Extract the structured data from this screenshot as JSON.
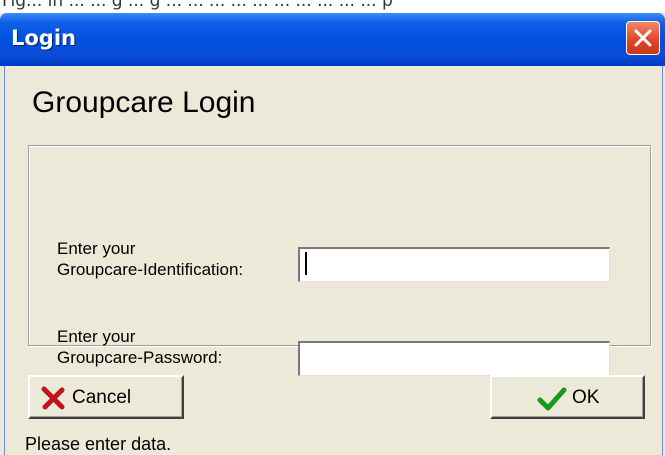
{
  "top_strip": {
    "text": "Fig... in ... ... g ... g ... ... ... ... ... ... ... ... ... ... p"
  },
  "window": {
    "title": "Login"
  },
  "heading": "Groupcare Login",
  "fields": {
    "identification": {
      "label_line1": "Enter your",
      "label_line2": "Groupcare-Identification:",
      "value": ""
    },
    "password": {
      "label_line1": "Enter your",
      "label_line2": "Groupcare-Password:",
      "value": ""
    }
  },
  "buttons": {
    "cancel": {
      "label": "Cancel",
      "icon": "red-x-icon"
    },
    "ok": {
      "label": "OK",
      "icon": "green-check-icon"
    },
    "close": {
      "icon": "close-icon"
    }
  },
  "status": "Please enter data.",
  "colors": {
    "titlebar": "#0050e0",
    "close": "#e0462a",
    "background": "#ece9d8",
    "cancel_icon": "#c0141a",
    "ok_icon": "#1a9a1a"
  }
}
